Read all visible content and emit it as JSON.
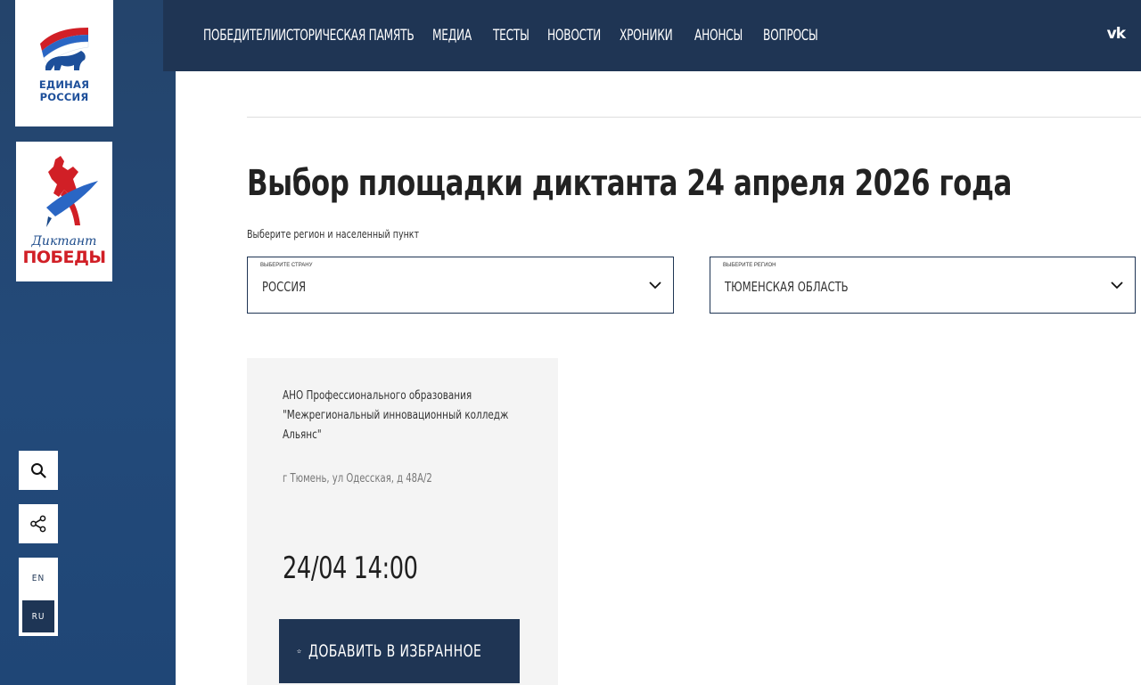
{
  "sidebar": {
    "logo_er_text_line1": "ЕДИНАЯ",
    "logo_er_text_line2": "РОССИЯ",
    "logo_dp_script": "Диктант",
    "logo_dp_bold": "ПОБЕДЫ",
    "lang_en": "EN",
    "lang_ru": "RU",
    "active_lang": "RU"
  },
  "nav": {
    "items": [
      {
        "label": "ПОБЕДИТЕЛИ"
      },
      {
        "label": "ИСТОРИЧЕСКАЯ ПАМЯТЬ"
      },
      {
        "label": "МЕДИА"
      },
      {
        "label": "ТЕСТЫ"
      },
      {
        "label": "НОВОСТИ"
      },
      {
        "label": "ХРОНИКИ"
      },
      {
        "label": "АНОНСЫ"
      },
      {
        "label": "ВОПРОСЫ"
      }
    ],
    "vk_label": "vk"
  },
  "main": {
    "title": "Выбор площадки диктанта 24 апреля 2026 года",
    "subtitle": "Выберите регион и населенный пункт",
    "country_select": {
      "label": "ВЫБЕРИТЕ СТРАНУ",
      "value": "РОССИЯ"
    },
    "region_select": {
      "label": "ВЫБЕРИТЕ РЕГИОН",
      "value": "ТЮМЕНСКАЯ ОБЛАСТЬ"
    },
    "card": {
      "name": "АНО Профессионального образования \"Межрегиональный инновационный колледж Альянс\"",
      "address": "г Тюмень, ул Одесская, д 48А/2",
      "datetime": "24/04 14:00",
      "fav_button": "ДОБАВИТЬ В ИЗБРАННОЕ"
    }
  },
  "colors": {
    "nav_bg": "#1f3554",
    "sidebar_bg": "#24446b",
    "card_bg": "#f4f4f4",
    "accent_red": "#d11f26",
    "accent_blue": "#1d4f9a"
  }
}
